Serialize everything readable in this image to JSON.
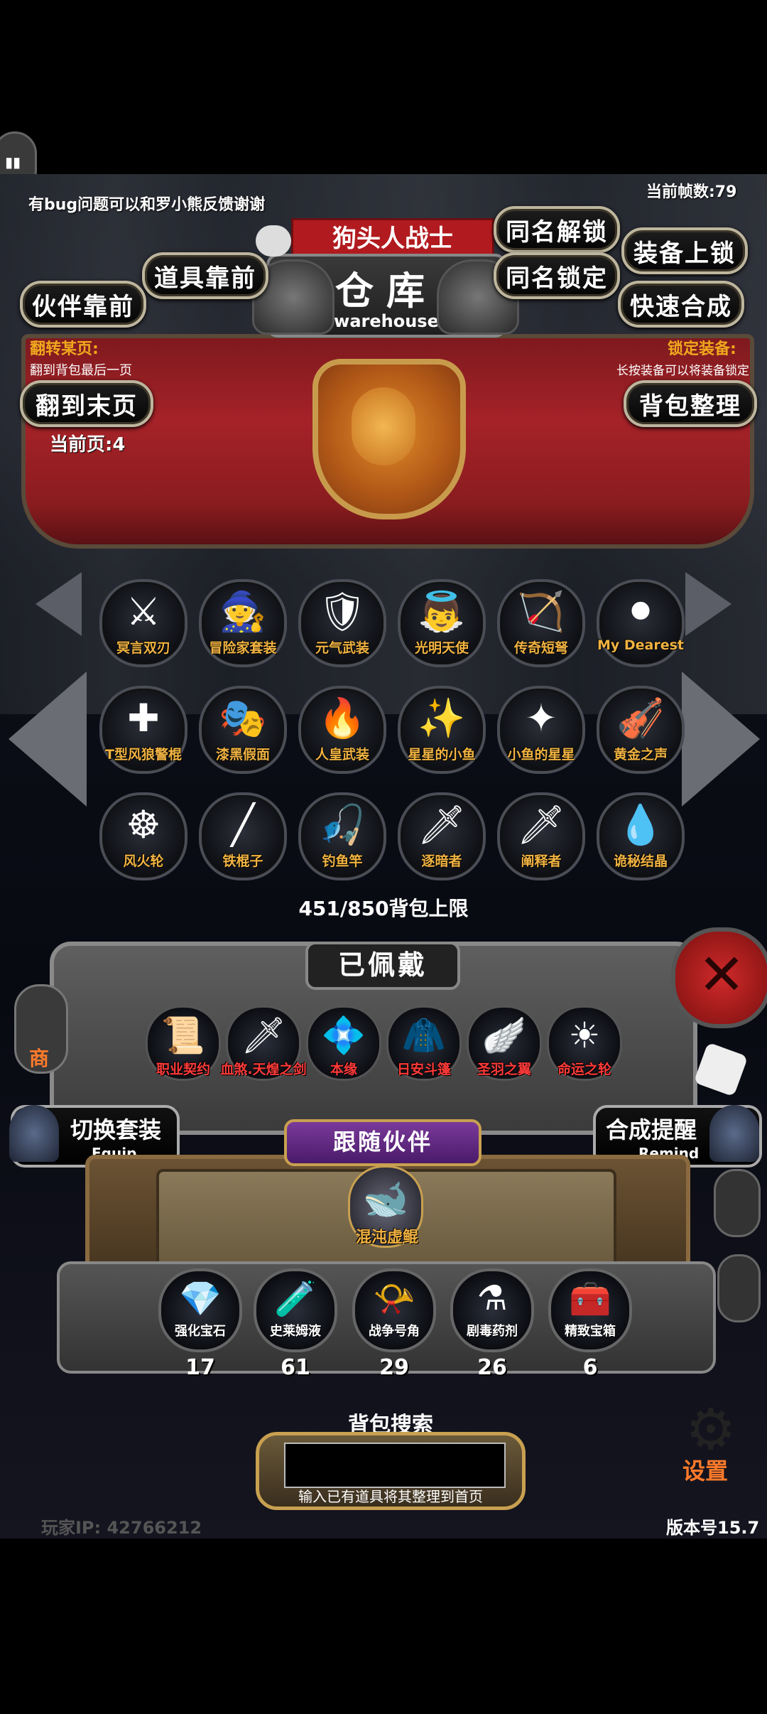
{
  "header": {
    "feedback": "有bug问题可以和罗小熊反馈谢谢",
    "fps": "当前帧数:79"
  },
  "title_plate": {
    "character": "狗头人战士",
    "title_cn": "仓库",
    "title_en": "warehouse"
  },
  "buttons": {
    "unlock_same_name": "同名解锁",
    "lock_equip": "装备上锁",
    "items_front": "道具靠前",
    "lock_same_name": "同名锁定",
    "partner_front": "伙伴靠前",
    "quick_synth": "快速合成",
    "last_page": "翻到末页",
    "sort_bag": "背包整理"
  },
  "banner": {
    "flip_label": "翻转某页:",
    "flip_hint": "翻到背包最后一页",
    "lock_label": "锁定装备:",
    "lock_hint": "长按装备可以将装备锁定",
    "current_page": "当前页:4"
  },
  "inventory": {
    "items": [
      {
        "name": "冥言双刃",
        "icon": "dual-blade-icon",
        "glyph": "⚔"
      },
      {
        "name": "冒险家套装",
        "icon": "adventurer-set-icon",
        "glyph": "🧙"
      },
      {
        "name": "元气武装",
        "icon": "armor-icon",
        "glyph": "🛡"
      },
      {
        "name": "光明天使",
        "icon": "angel-icon",
        "glyph": "👼"
      },
      {
        "name": "传奇短弩",
        "icon": "crossbow-icon",
        "glyph": "🏹"
      },
      {
        "name": "My Dearest",
        "icon": "dark-orb-icon",
        "glyph": "⚫"
      },
      {
        "name": "T型风狼警棍",
        "icon": "baton-icon",
        "glyph": "✚"
      },
      {
        "name": "漆黑假面",
        "icon": "mask-icon",
        "glyph": "🎭"
      },
      {
        "name": "人皇武装",
        "icon": "emperor-armor-icon",
        "glyph": "🔥"
      },
      {
        "name": "星星的小鱼",
        "icon": "star-fish-icon",
        "glyph": "✨"
      },
      {
        "name": "小鱼的星星",
        "icon": "fish-star-icon",
        "glyph": "✦"
      },
      {
        "name": "黄金之声",
        "icon": "harp-icon",
        "glyph": "🎻"
      },
      {
        "name": "风火轮",
        "icon": "wheel-icon",
        "glyph": "☸"
      },
      {
        "name": "铁棍子",
        "icon": "iron-rod-icon",
        "glyph": "╱"
      },
      {
        "name": "钓鱼竿",
        "icon": "fishing-rod-icon",
        "glyph": "🎣"
      },
      {
        "name": "逐暗者",
        "icon": "sword-icon",
        "glyph": "🗡"
      },
      {
        "name": "阐释者",
        "icon": "dark-sword-icon",
        "glyph": "🗡"
      },
      {
        "name": "诡秘结晶",
        "icon": "crystal-icon",
        "glyph": "💧"
      }
    ],
    "capacity": "451/850背包上限"
  },
  "equipped": {
    "title": "已佩戴",
    "items": [
      {
        "name": "职业契约",
        "icon": "scroll-icon",
        "glyph": "📜"
      },
      {
        "name": "血煞.天煌之剑",
        "icon": "blood-sword-icon",
        "glyph": "🗡"
      },
      {
        "name": "本缘",
        "icon": "origin-icon",
        "glyph": "💠"
      },
      {
        "name": "日安斗篷",
        "icon": "cloak-icon",
        "glyph": "🧥"
      },
      {
        "name": "圣羽之翼",
        "icon": "wings-icon",
        "glyph": "🪽"
      },
      {
        "name": "命运之轮",
        "icon": "fate-wheel-icon",
        "glyph": "☀"
      }
    ]
  },
  "side": {
    "switch_set": "切换套装",
    "switch_set_en": "Equip",
    "synth_remind": "合成提醒",
    "synth_remind_en": "Remind",
    "follow_partner": "跟随伙伴",
    "partner_name": "混沌虚鲲",
    "shop": "商",
    "settings": "设置"
  },
  "materials": [
    {
      "name": "强化宝石",
      "count": "17",
      "icon": "green-gem-icon",
      "glyph": "💎"
    },
    {
      "name": "史莱姆液",
      "count": "61",
      "icon": "slime-potion-icon",
      "glyph": "🧪"
    },
    {
      "name": "战争号角",
      "count": "29",
      "icon": "war-horn-icon",
      "glyph": "📯"
    },
    {
      "name": "剧毒药剂",
      "count": "26",
      "icon": "poison-potion-icon",
      "glyph": "⚗"
    },
    {
      "name": "精致宝箱",
      "count": "6",
      "icon": "treasure-chest-icon",
      "glyph": "🧰"
    }
  ],
  "search": {
    "title": "背包搜索",
    "hint": "输入已有道具将其整理到首页",
    "placeholder": ""
  },
  "footer": {
    "player_ip": "玩家IP:  42766212",
    "version": "版本号15.7"
  }
}
